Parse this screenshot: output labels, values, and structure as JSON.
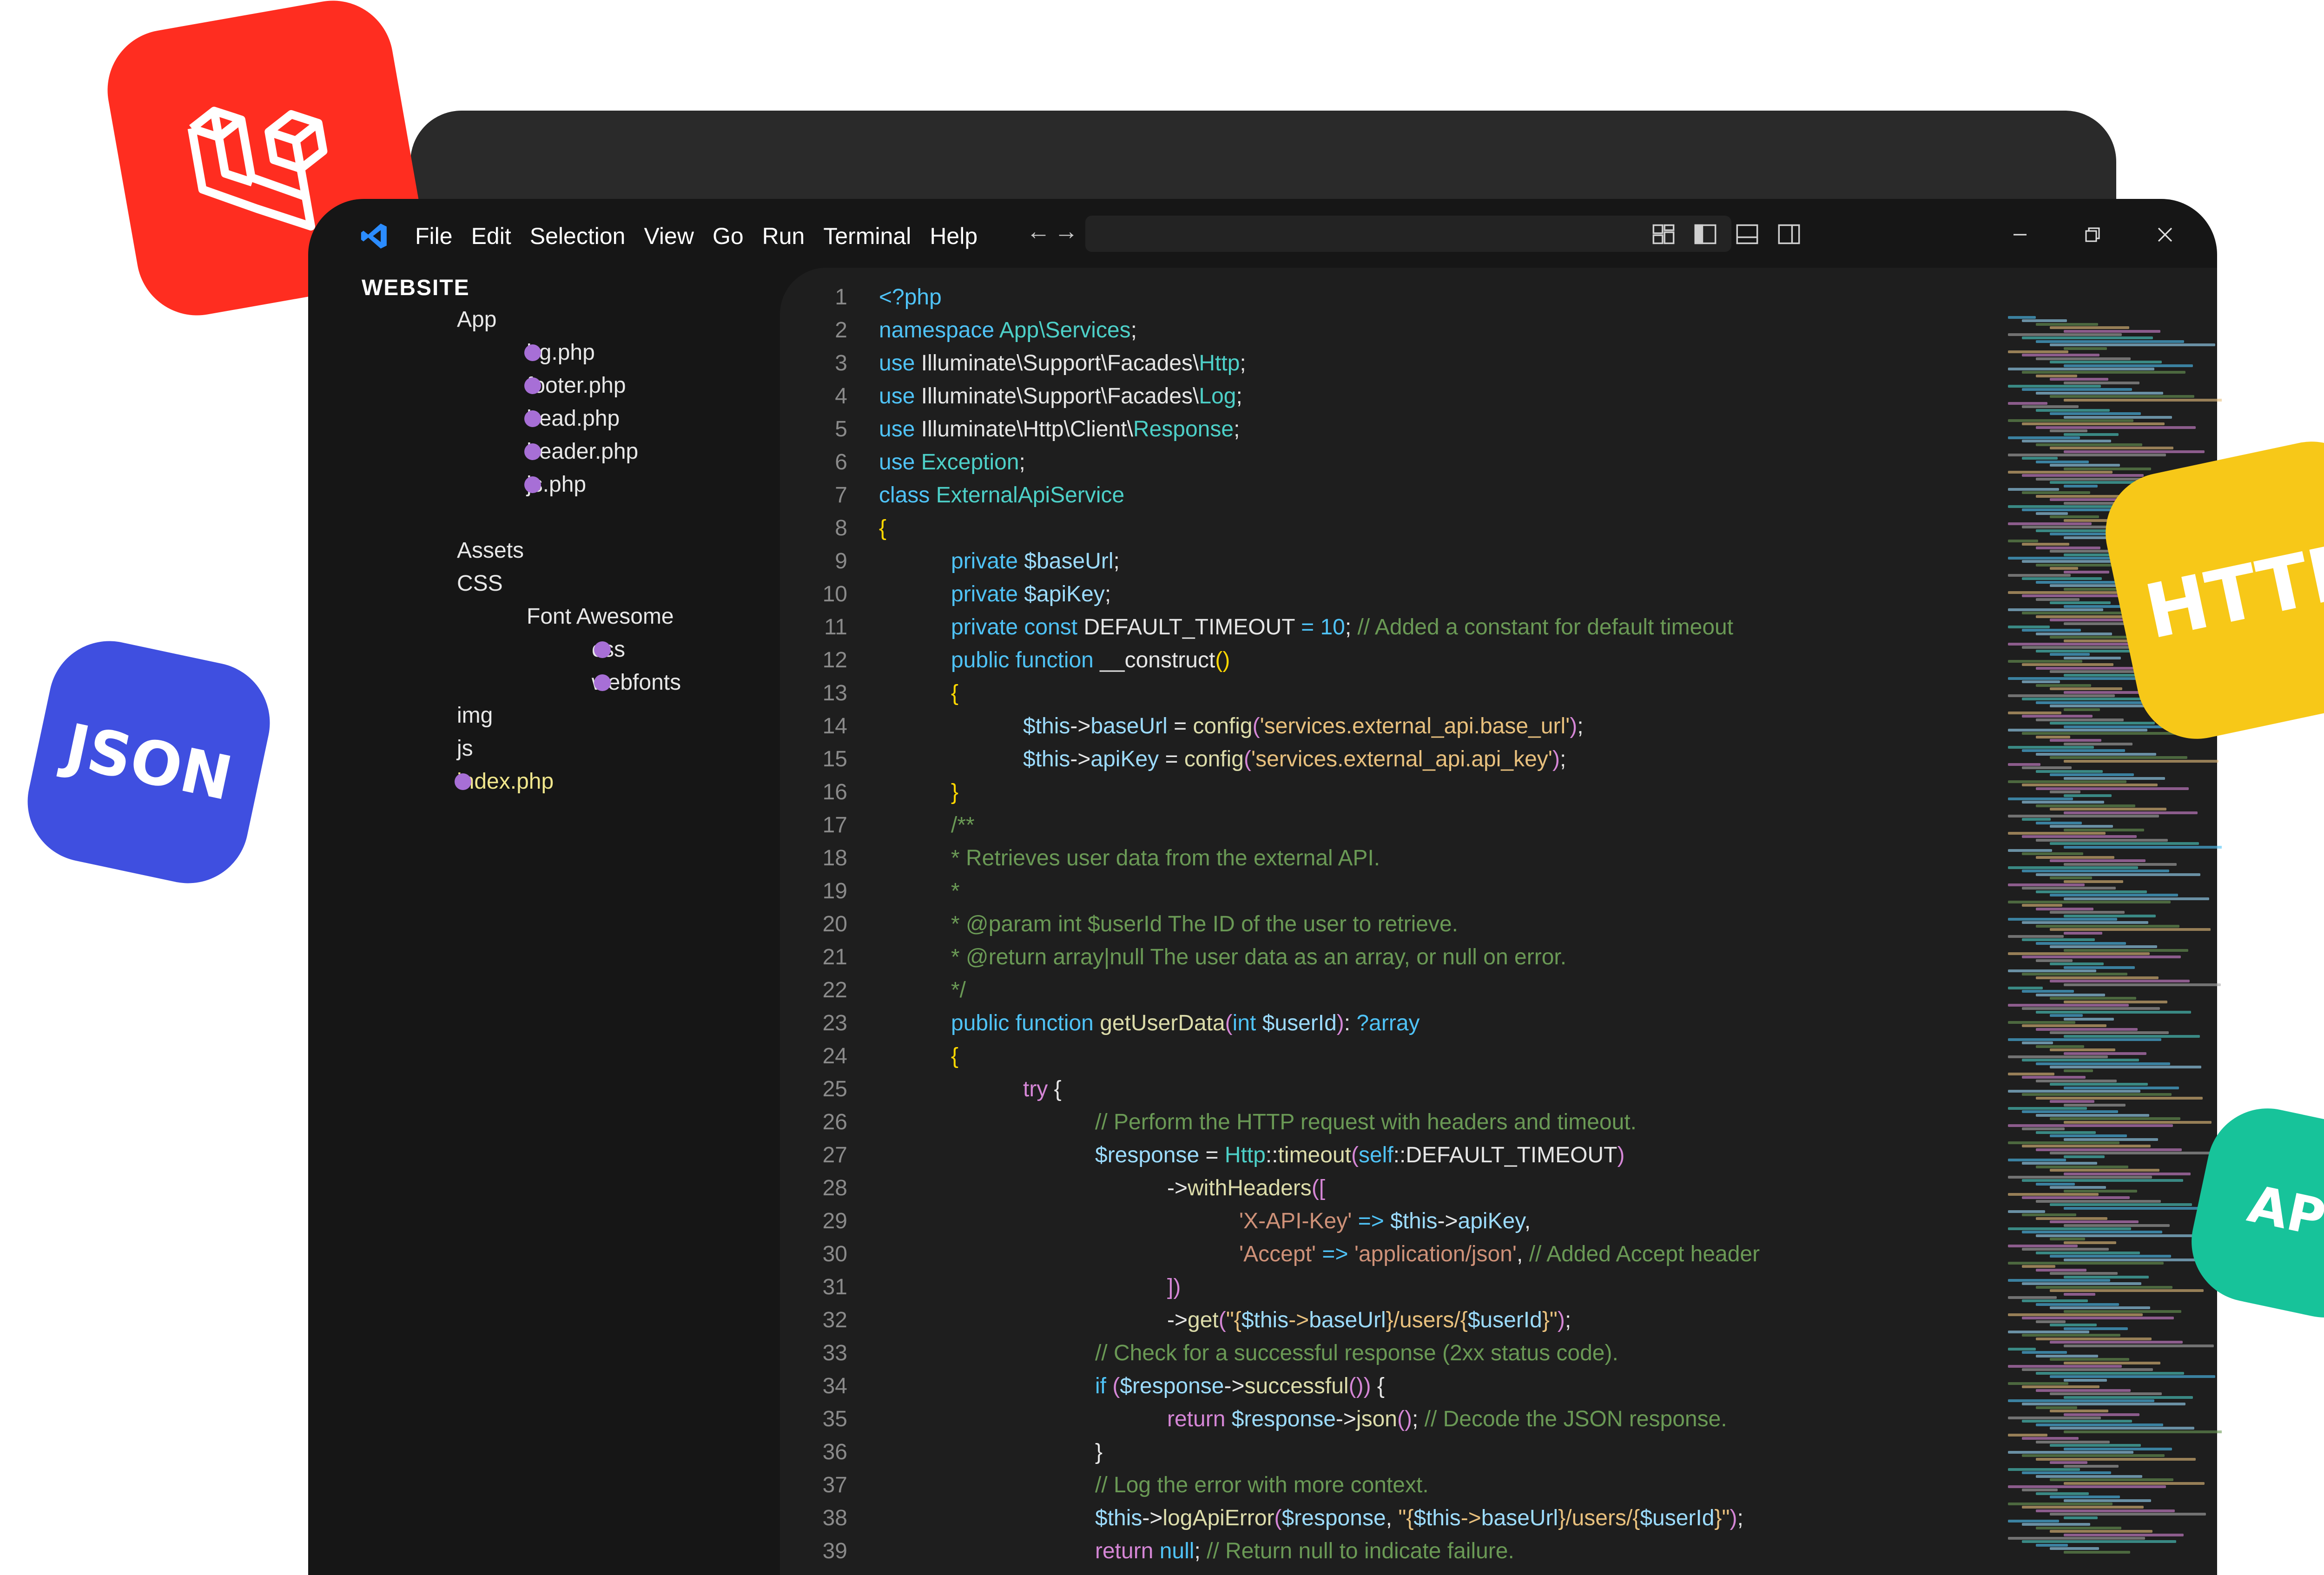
{
  "menu": [
    "File",
    "Edit",
    "Selection",
    "View",
    "Go",
    "Run",
    "Terminal",
    "Help"
  ],
  "nav_arrows": "←→",
  "explorer": {
    "root": "WEBSITE",
    "items": [
      {
        "label": "App",
        "depth": 1,
        "dot": false
      },
      {
        "label": "bg.php",
        "depth": 2,
        "dot": true
      },
      {
        "label": "footer.php",
        "depth": 2,
        "dot": true
      },
      {
        "label": "head.php",
        "depth": 2,
        "dot": true
      },
      {
        "label": "header.php",
        "depth": 2,
        "dot": true
      },
      {
        "label": "js.php",
        "depth": 2,
        "dot": true
      },
      {
        "label": "",
        "depth": 0,
        "dot": false
      },
      {
        "label": "Assets",
        "depth": 1,
        "dot": false
      },
      {
        "label": "CSS",
        "depth": 1,
        "dot": false
      },
      {
        "label": "Font Awesome",
        "depth": 2,
        "dot": false
      },
      {
        "label": "css",
        "depth": 3,
        "dot": true
      },
      {
        "label": "webfonts",
        "depth": 3,
        "dot": true
      },
      {
        "label": "img",
        "depth": 1,
        "dot": false
      },
      {
        "label": "js",
        "depth": 1,
        "dot": false
      },
      {
        "label": "index.php",
        "depth": 1,
        "dot": true,
        "highlight": true
      }
    ]
  },
  "code_lines": [
    {
      "n": "1",
      "i": 0,
      "t": [
        [
          "kw",
          "<?php"
        ]
      ]
    },
    {
      "n": "2",
      "i": 0,
      "t": [
        [
          "kw",
          "namespace "
        ],
        [
          "ty",
          "App\\Services"
        ],
        [
          "pl",
          ";"
        ]
      ]
    },
    {
      "n": "3",
      "i": 0,
      "t": [
        [
          "kw",
          "use "
        ],
        [
          "pl",
          "Illuminate\\Support\\Facades\\"
        ],
        [
          "ty",
          "Http"
        ],
        [
          "pl",
          ";"
        ]
      ]
    },
    {
      "n": "4",
      "i": 0,
      "t": [
        [
          "kw",
          "use "
        ],
        [
          "pl",
          "Illuminate\\Support\\Facades\\"
        ],
        [
          "ty",
          "Log"
        ],
        [
          "pl",
          ";"
        ]
      ]
    },
    {
      "n": "5",
      "i": 0,
      "t": [
        [
          "kw",
          "use "
        ],
        [
          "pl",
          "Illuminate\\Http\\Client\\"
        ],
        [
          "ty",
          "Response"
        ],
        [
          "pl",
          ";"
        ]
      ]
    },
    {
      "n": "6",
      "i": 0,
      "t": [
        [
          "kw",
          "use "
        ],
        [
          "ty",
          "Exception"
        ],
        [
          "pl",
          ";"
        ]
      ]
    },
    {
      "n": "7",
      "i": 0,
      "t": [
        [
          "kw",
          "class "
        ],
        [
          "ty",
          "ExternalApiService"
        ]
      ]
    },
    {
      "n": "8",
      "i": 0,
      "t": [
        [
          "br",
          "{"
        ]
      ]
    },
    {
      "n": "9",
      "i": 1,
      "t": [
        [
          "kw",
          "private "
        ],
        [
          "va",
          "$baseUrl"
        ],
        [
          "pl",
          ";"
        ]
      ]
    },
    {
      "n": "10",
      "i": 1,
      "t": [
        [
          "kw",
          "private "
        ],
        [
          "va",
          "$apiKey"
        ],
        [
          "pl",
          ";"
        ]
      ]
    },
    {
      "n": "11",
      "i": 1,
      "t": [
        [
          "kw",
          "private const "
        ],
        [
          "pl",
          "DEFAULT_TIMEOUT "
        ],
        [
          "kw",
          "= "
        ],
        [
          "kw",
          "10"
        ],
        [
          "pl",
          "; "
        ],
        [
          "cm",
          "// Added a constant for default timeout"
        ]
      ]
    },
    {
      "n": "12",
      "i": 1,
      "t": [
        [
          "kw",
          "public function "
        ],
        [
          "pl",
          "__construct"
        ],
        [
          "br",
          "()"
        ]
      ]
    },
    {
      "n": "13",
      "i": 1,
      "t": [
        [
          "br",
          "{"
        ]
      ]
    },
    {
      "n": "14",
      "i": 2,
      "t": [
        [
          "va",
          "$this"
        ],
        [
          "pl",
          "->"
        ],
        [
          "va",
          "baseUrl"
        ],
        [
          "pl",
          " = "
        ],
        [
          "fn",
          "config"
        ],
        [
          "pu",
          "("
        ],
        [
          "str2",
          "'services.external_api.base_url'"
        ],
        [
          "pu",
          ")"
        ],
        [
          "pl",
          ";"
        ]
      ]
    },
    {
      "n": "15",
      "i": 2,
      "t": [
        [
          "va",
          "$this"
        ],
        [
          "pl",
          "->"
        ],
        [
          "va",
          "apiKey"
        ],
        [
          "pl",
          " = "
        ],
        [
          "fn",
          "config"
        ],
        [
          "pu",
          "("
        ],
        [
          "str2",
          "'services.external_api.api_key'"
        ],
        [
          "pu",
          ")"
        ],
        [
          "pl",
          ";"
        ]
      ]
    },
    {
      "n": "16",
      "i": 1,
      "t": [
        [
          "br",
          "}"
        ]
      ]
    },
    {
      "n": "17",
      "i": 1,
      "t": [
        [
          "cm",
          "/**"
        ]
      ]
    },
    {
      "n": "18",
      "i": 1,
      "t": [
        [
          "cm",
          "* Retrieves user data from the external API."
        ]
      ]
    },
    {
      "n": "19",
      "i": 1,
      "t": [
        [
          "cm",
          "*"
        ]
      ]
    },
    {
      "n": "20",
      "i": 1,
      "t": [
        [
          "cm",
          "* @param int $userId The ID of the user to retrieve."
        ]
      ]
    },
    {
      "n": "21",
      "i": 1,
      "t": [
        [
          "cm",
          "* @return array|null The user data as an array, or null on error."
        ]
      ]
    },
    {
      "n": "22",
      "i": 1,
      "t": [
        [
          "cm",
          "*/"
        ]
      ]
    },
    {
      "n": "23",
      "i": 1,
      "t": [
        [
          "kw",
          "public function "
        ],
        [
          "fn",
          "getUserData"
        ],
        [
          "pu",
          "("
        ],
        [
          "kw",
          "int "
        ],
        [
          "va",
          "$userId"
        ],
        [
          "pu",
          ")"
        ],
        [
          "pl",
          ": "
        ],
        [
          "kw",
          "?array"
        ]
      ]
    },
    {
      "n": "24",
      "i": 1,
      "t": [
        [
          "br",
          "{"
        ]
      ]
    },
    {
      "n": "25",
      "i": 2,
      "t": [
        [
          "pu",
          "try "
        ],
        [
          "pl",
          "{"
        ]
      ]
    },
    {
      "n": "26",
      "i": 3,
      "t": [
        [
          "cm",
          "// Perform the HTTP request with headers and timeout."
        ]
      ]
    },
    {
      "n": "27",
      "i": 3,
      "t": [
        [
          "va",
          "$response"
        ],
        [
          "pl",
          " = "
        ],
        [
          "ty",
          "Http"
        ],
        [
          "pl",
          "::"
        ],
        [
          "fn",
          "timeout"
        ],
        [
          "pu",
          "("
        ],
        [
          "kw",
          "self"
        ],
        [
          "pl",
          "::DEFAULT_TIMEOUT"
        ],
        [
          "pu",
          ")"
        ]
      ]
    },
    {
      "n": "28",
      "i": 4,
      "t": [
        [
          "pl",
          "->"
        ],
        [
          "fn",
          "withHeaders"
        ],
        [
          "pu",
          "(["
        ]
      ]
    },
    {
      "n": "29",
      "i": 5,
      "t": [
        [
          "st",
          "'X-API-Key'"
        ],
        [
          "kw",
          " => "
        ],
        [
          "va",
          "$this"
        ],
        [
          "pl",
          "->"
        ],
        [
          "va",
          "apiKey"
        ],
        [
          "pl",
          ","
        ]
      ]
    },
    {
      "n": "30",
      "i": 5,
      "t": [
        [
          "st",
          "'Accept'"
        ],
        [
          "kw",
          " => "
        ],
        [
          "st",
          "'application/json'"
        ],
        [
          "pl",
          ", "
        ],
        [
          "cm",
          "// Added Accept header"
        ]
      ]
    },
    {
      "n": "31",
      "i": 4,
      "t": [
        [
          "pu",
          "])"
        ]
      ]
    },
    {
      "n": "32",
      "i": 4,
      "t": [
        [
          "pl",
          "->"
        ],
        [
          "fn",
          "get"
        ],
        [
          "pu",
          "("
        ],
        [
          "str2",
          "\"{"
        ],
        [
          "va",
          "$this"
        ],
        [
          "str2",
          "->"
        ],
        [
          "va",
          "baseUrl"
        ],
        [
          "str2",
          "}/users/{"
        ],
        [
          "va",
          "$userId"
        ],
        [
          "str2",
          "}\""
        ],
        [
          "pu",
          ")"
        ],
        [
          "pl",
          ";"
        ]
      ]
    },
    {
      "n": "33",
      "i": 3,
      "t": [
        [
          "cm",
          "// Check for a successful response (2xx status code)."
        ]
      ]
    },
    {
      "n": "34",
      "i": 3,
      "t": [
        [
          "kw",
          "if "
        ],
        [
          "pu",
          "("
        ],
        [
          "va",
          "$response"
        ],
        [
          "pl",
          "->"
        ],
        [
          "fn",
          "successful"
        ],
        [
          "pu",
          "())"
        ],
        [
          "pl",
          " {"
        ]
      ]
    },
    {
      "n": "35",
      "i": 4,
      "t": [
        [
          "pu",
          "return "
        ],
        [
          "va",
          "$response"
        ],
        [
          "pl",
          "->"
        ],
        [
          "fn",
          "json"
        ],
        [
          "pu",
          "()"
        ],
        [
          "pl",
          "; "
        ],
        [
          "cm",
          "// Decode the JSON response."
        ]
      ]
    },
    {
      "n": "36",
      "i": 3,
      "t": [
        [
          "pl",
          "}"
        ]
      ]
    },
    {
      "n": "37",
      "i": 3,
      "t": [
        [
          "cm",
          "// Log the error with more context."
        ]
      ]
    },
    {
      "n": "38",
      "i": 3,
      "t": [
        [
          "va",
          "$this"
        ],
        [
          "pl",
          "->"
        ],
        [
          "fn",
          "logApiError"
        ],
        [
          "pu",
          "("
        ],
        [
          "va",
          "$response"
        ],
        [
          "pl",
          ", "
        ],
        [
          "str2",
          "\"{"
        ],
        [
          "va",
          "$this"
        ],
        [
          "str2",
          "->"
        ],
        [
          "va",
          "baseUrl"
        ],
        [
          "str2",
          "}/users/{"
        ],
        [
          "va",
          "$userId"
        ],
        [
          "str2",
          "}\""
        ],
        [
          "pu",
          ")"
        ],
        [
          "pl",
          ";"
        ]
      ]
    },
    {
      "n": "39",
      "i": 3,
      "t": [
        [
          "pu",
          "return "
        ],
        [
          "kw",
          "null"
        ],
        [
          "pl",
          "; "
        ],
        [
          "cm",
          "// Return null to indicate failure."
        ]
      ]
    }
  ],
  "badges": {
    "json": {
      "label": "JSON",
      "color": "#3f4fe0"
    },
    "http": {
      "label": "HTTP",
      "color": "#f7c818"
    },
    "api": {
      "label": "API",
      "color": "#17c39a"
    },
    "laravel": {
      "label": "",
      "color": "#ff2d20"
    }
  },
  "colors": {
    "window_bg": "#161616",
    "editor_bg": "#1e1e1e",
    "file_dot": "#a76fd6",
    "accent_blue": "#2b8cff"
  }
}
